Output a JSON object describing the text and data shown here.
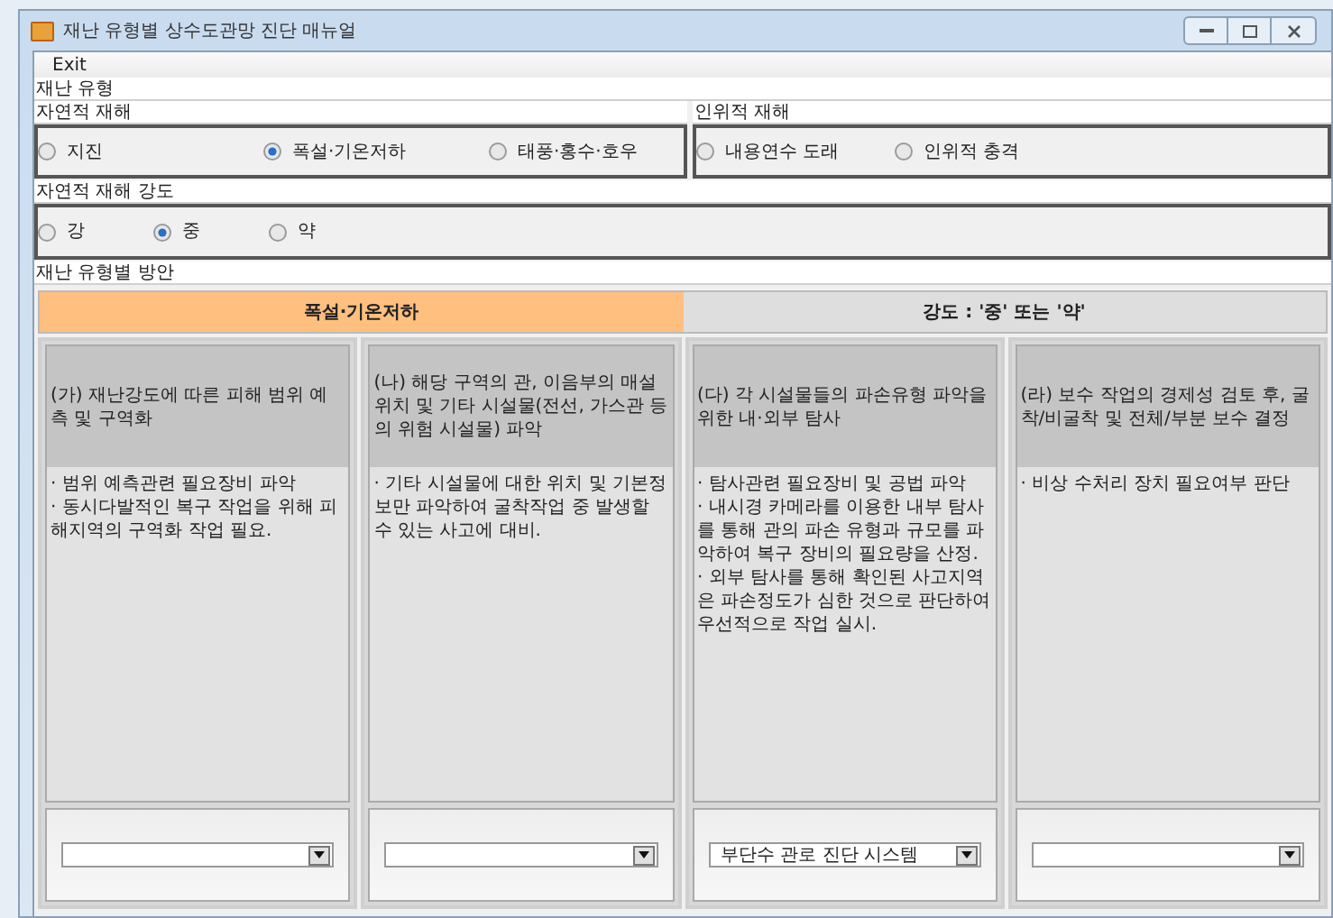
{
  "window": {
    "title": "재난 유형별 상수도관망 진단 매뉴얼"
  },
  "menu": [
    "Exit"
  ],
  "disaster_type": {
    "label": "재난 유형",
    "groups": [
      {
        "label": "자연적 재해",
        "options": [
          {
            "label": "지진",
            "selected": false
          },
          {
            "label": "폭설·기온저하",
            "selected": true
          },
          {
            "label": "태풍·홍수·호우",
            "selected": false
          }
        ]
      },
      {
        "label": "인위적 재해",
        "options": [
          {
            "label": "내용연수 도래",
            "selected": false
          },
          {
            "label": "인위적 충격",
            "selected": false
          }
        ]
      }
    ]
  },
  "intensity": {
    "label": "자연적 재해 강도",
    "options": [
      {
        "label": "강",
        "selected": false
      },
      {
        "label": "중",
        "selected": true
      },
      {
        "label": "약",
        "selected": false
      }
    ]
  },
  "plan": {
    "label": "재난 유형별 방안",
    "headers": [
      {
        "label": "폭설·기온저하",
        "selected": true
      },
      {
        "label": "강도 : '중' 또는 '약'",
        "selected": false
      }
    ],
    "columns": [
      {
        "heading": "(가) 재난강도에 따른 피해 범위 예측 및 구역화",
        "items": [
          "· 범위 예측관련 필요장비 파악",
          "· 동시다발적인 복구 작업을 위해 피해지역의 구역화 작업 필요."
        ]
      },
      {
        "heading": "(나) 해당 구역의 관, 이음부의 매설위치 및 기타 시설물(전선, 가스관 등의 위험 시설물) 파악",
        "items": [
          "· 기타 시설물에 대한 위치 및 기본정보만 파악하여 굴착작업 중 발생할 수 있는 사고에 대비."
        ]
      },
      {
        "heading": "(다) 각 시설물들의 파손유형 파악을 위한 내·외부 탐사",
        "items": [
          "· 탐사관련 필요장비 및 공법 파악",
          "· 내시경 카메라를 이용한 내부 탐사를 통해 관의 파손 유형과 규모를 파악하여 복구 장비의 필요량을 산정.",
          "· 외부 탐사를 통해 확인된 사고지역은 파손정도가 심한 것으로 판단하여 우선적으로 작업 실시."
        ],
        "combo": {
          "value": "부단수 관로 진단 시스템"
        }
      },
      {
        "heading": "(라) 보수 작업의 경제성 검토 후, 굴착/비굴착 및 전체/부분 보수 결정",
        "items": [
          "· 비상 수처리 장치 필요여부 판단"
        ]
      }
    ]
  }
}
